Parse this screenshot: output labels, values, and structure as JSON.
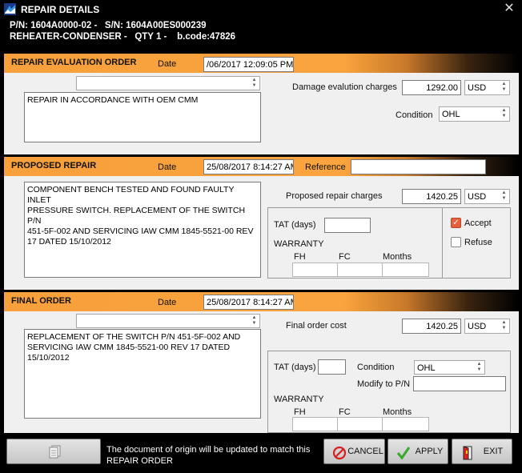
{
  "window": {
    "title": "REPAIR DETAILS",
    "close_glyph": "✕"
  },
  "info": {
    "line1": "P/N: 1604A0000-02 -   S/N: 1604A00ES000239",
    "line2": "REHEATER-CONDENSER -   QTY 1 -    b.code:47826"
  },
  "evaluation": {
    "header": "REPAIR EVALUATION ORDER",
    "date_label": "Date",
    "date_value": "/06/2017 12:09:05 PM",
    "selector_value": "",
    "text": "REPAIR IN ACCORDANCE WITH OEM CMM",
    "charges_label": "Damage evalution charges",
    "charges_value": "1292.00",
    "currency": "USD",
    "condition_label": "Condition",
    "condition_value": "OHL"
  },
  "proposed": {
    "header": "PROPOSED REPAIR",
    "date_label": "Date",
    "date_value": "25/08/2017 8:14:27 AM",
    "reference_label": "Reference",
    "reference_value": "",
    "text": "COMPONENT BENCH TESTED AND FOUND FAULTY INLET\nPRESSURE SWITCH. REPLACEMENT OF THE SWITCH P/N\n451-5F-002 AND SERVICING IAW CMM 1845-5521-00 REV\n17 DATED 15/10/2012",
    "charges_label": "Proposed repair charges",
    "charges_value": "1420.25",
    "currency": "USD",
    "tat_label": "TAT (days)",
    "tat_value": "",
    "warranty_label": "WARRANTY",
    "fh_label": "FH",
    "fc_label": "FC",
    "months_label": "Months",
    "accept_label": "Accept",
    "accept_checked": true,
    "refuse_label": "Refuse",
    "refuse_checked": false
  },
  "final": {
    "header": "FINAL ORDER",
    "date_label": "Date",
    "date_value": "25/08/2017 8:14:27 AM",
    "selector_value": "",
    "text": "REPLACEMENT OF THE SWITCH P/N 451-5F-002 AND\nSERVICING IAW CMM 1845-5521-00 REV 17 DATED\n15/10/2012",
    "cost_label": "Final order cost",
    "cost_value": "1420.25",
    "currency": "USD",
    "tat_label": "TAT (days)",
    "tat_value": "",
    "condition_label": "Condition",
    "condition_value": "OHL",
    "modify_label": "Modify to P/N",
    "modify_value": "",
    "warranty_label": "WARRANTY",
    "fh_label": "FH",
    "fc_label": "FC",
    "months_label": "Months"
  },
  "footer": {
    "message": "The document of origin will be updated to match this REPAIR ORDER",
    "cancel_label": "CANCEL",
    "apply_label": "APPLY",
    "exit_label": "EXIT",
    "doc_icon": "document-stack-icon"
  },
  "colors": {
    "header_orange": "#f9a43e",
    "panel_gray": "#f0f0f0",
    "accept_check": "#e8603a",
    "apply_green": "#3aa82a",
    "cancel_red": "#d62020"
  }
}
